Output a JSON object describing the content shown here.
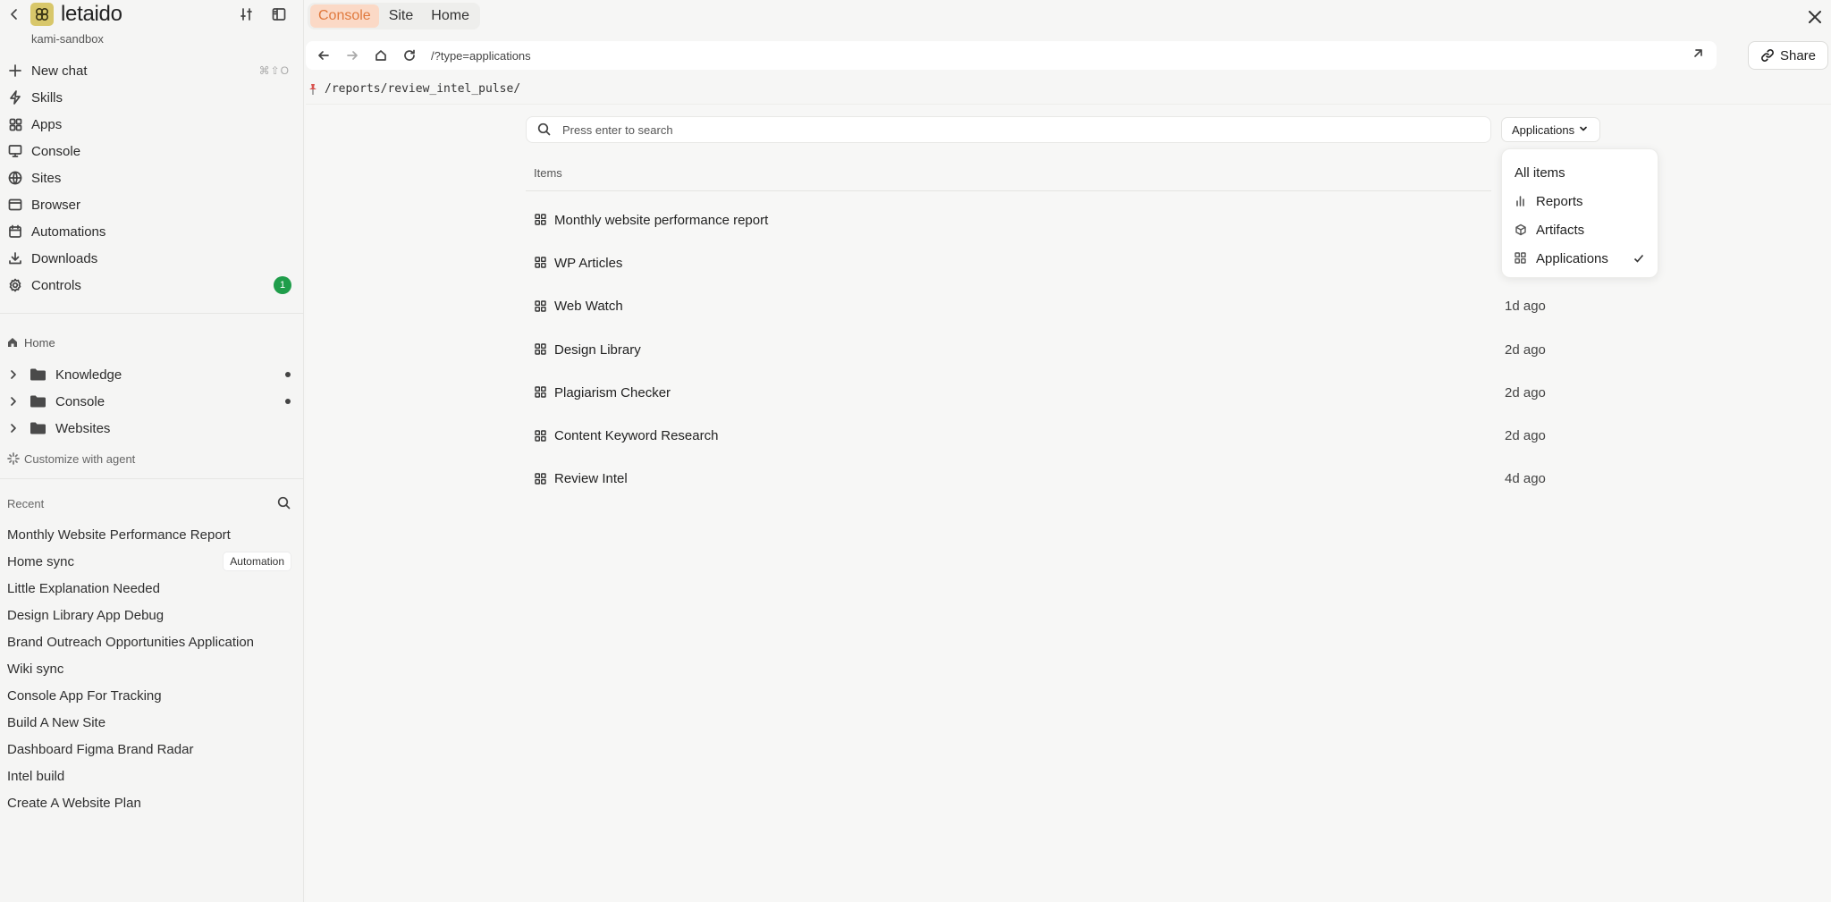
{
  "brand": {
    "name": "letaido",
    "workspace": "kami-sandbox"
  },
  "nav": [
    {
      "label": "New chat",
      "icon": "plus-icon",
      "shortcut": "⌘⇧O"
    },
    {
      "label": "Skills",
      "icon": "bolt-icon"
    },
    {
      "label": "Apps",
      "icon": "grid-icon"
    },
    {
      "label": "Console",
      "icon": "monitor-icon"
    },
    {
      "label": "Sites",
      "icon": "globe-icon"
    },
    {
      "label": "Browser",
      "icon": "browser-icon"
    },
    {
      "label": "Automations",
      "icon": "calendar-icon"
    },
    {
      "label": "Downloads",
      "icon": "download-icon"
    },
    {
      "label": "Controls",
      "icon": "gear-icon",
      "badge": "1"
    }
  ],
  "home": {
    "label": "Home"
  },
  "tree": [
    {
      "label": "Knowledge",
      "dot": true
    },
    {
      "label": "Console",
      "dot": true
    },
    {
      "label": "Websites",
      "dot": false
    }
  ],
  "customize": {
    "label": "Customize with agent"
  },
  "recent": {
    "title": "Recent",
    "items": [
      {
        "label": "Monthly Website Performance Report"
      },
      {
        "label": "Home sync",
        "tag": "Automation"
      },
      {
        "label": "Little Explanation Needed"
      },
      {
        "label": "Design Library App Debug"
      },
      {
        "label": "Brand Outreach Opportunities Application"
      },
      {
        "label": "Wiki sync"
      },
      {
        "label": "Console App For Tracking"
      },
      {
        "label": "Build A New Site"
      },
      {
        "label": "Dashboard Figma Brand Radar"
      },
      {
        "label": "Intel build"
      },
      {
        "label": "Create A Website Plan"
      }
    ]
  },
  "tabs": [
    {
      "label": "Console",
      "active": true
    },
    {
      "label": "Site",
      "active": false
    },
    {
      "label": "Home",
      "active": false
    }
  ],
  "urlbar": {
    "url": "/?type=applications"
  },
  "share": {
    "label": "Share"
  },
  "path": "/reports/review_intel_pulse/",
  "search": {
    "placeholder": "Press enter to search"
  },
  "filter": {
    "label": "Applications"
  },
  "items_header": "Items",
  "items": [
    {
      "name": "Monthly website performance report",
      "time": ""
    },
    {
      "name": "WP Articles",
      "time": ""
    },
    {
      "name": "Web Watch",
      "time": "1d ago"
    },
    {
      "name": "Design Library",
      "time": "2d ago"
    },
    {
      "name": "Plagiarism Checker",
      "time": "2d ago"
    },
    {
      "name": "Content Keyword Research",
      "time": "2d ago"
    },
    {
      "name": "Review Intel",
      "time": "4d ago"
    }
  ],
  "dropdown": {
    "options": [
      {
        "label": "All items",
        "icon": ""
      },
      {
        "label": "Reports",
        "icon": "bar-chart-icon"
      },
      {
        "label": "Artifacts",
        "icon": "cube-icon"
      },
      {
        "label": "Applications",
        "icon": "grid-icon",
        "selected": true
      }
    ]
  },
  "colors": {
    "accent": "#e0793d",
    "accent_bg": "#fbd9c6",
    "badge_green": "#1f9d4a",
    "logo_bg": "#d8c76a"
  }
}
